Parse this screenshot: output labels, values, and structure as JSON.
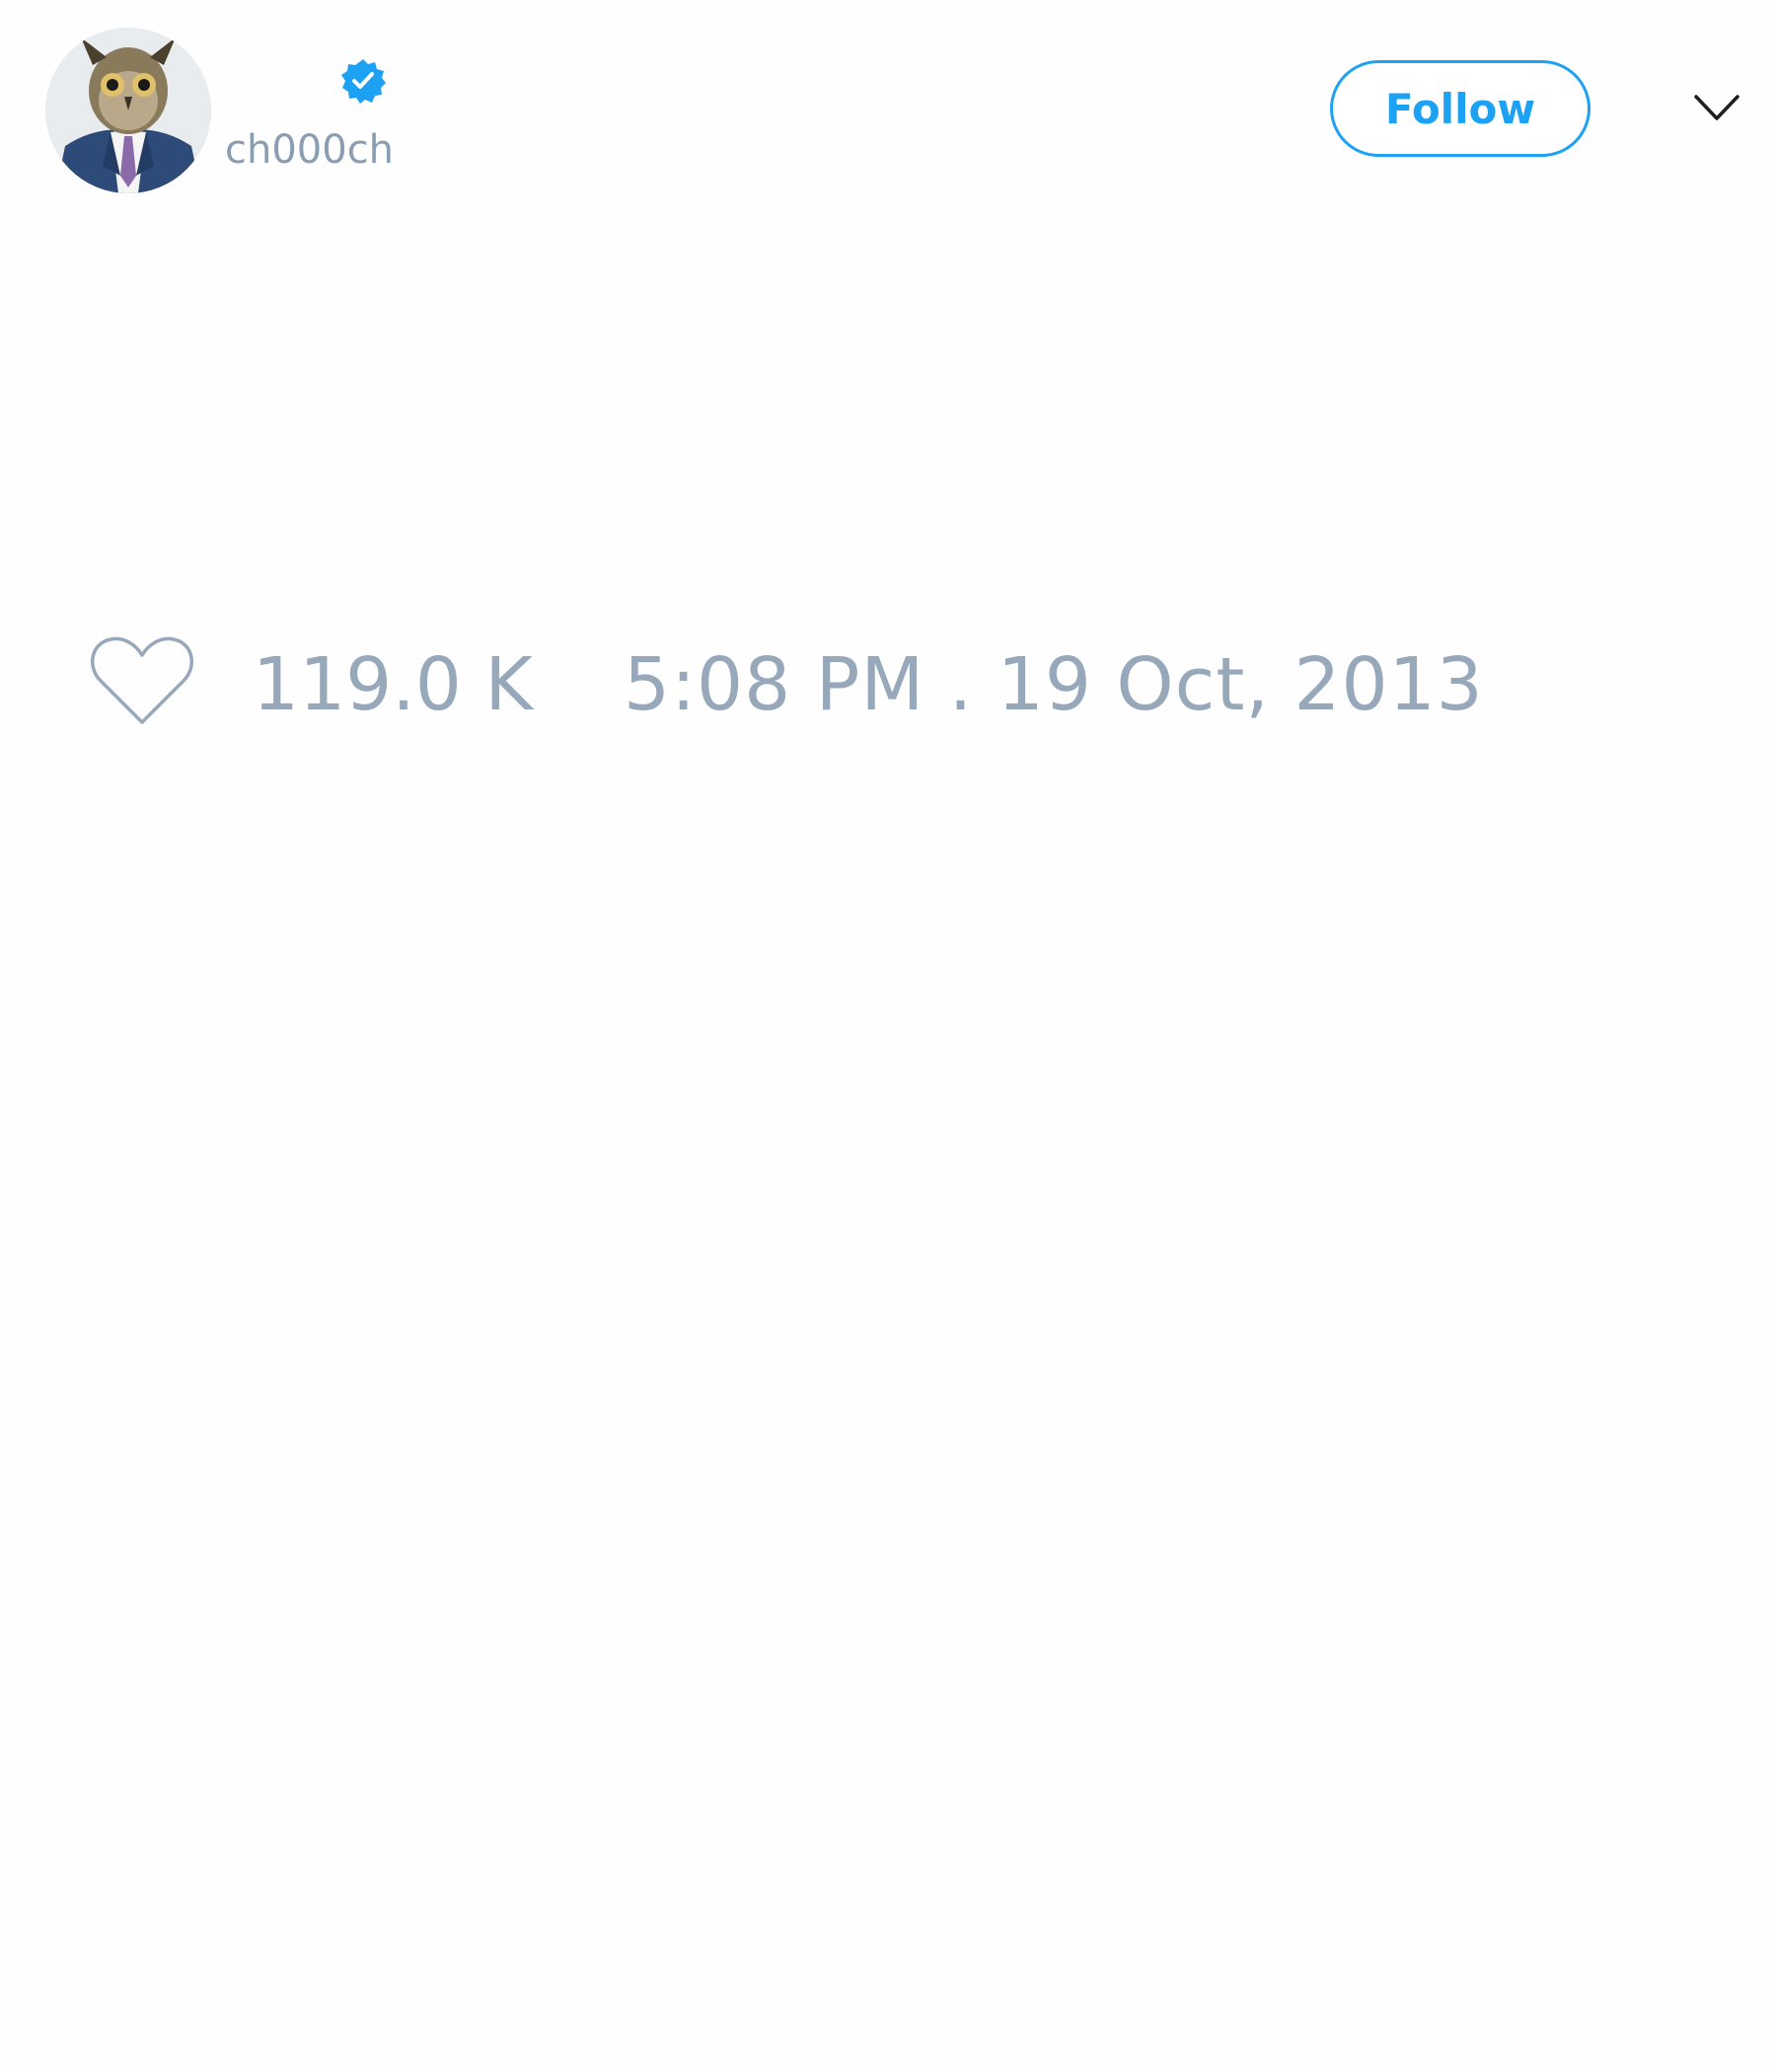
{
  "tweet": {
    "author": {
      "handle": "ch000ch",
      "verified": true,
      "avatar_icon": "owl-in-suit-avatar"
    },
    "follow_label": "Follow",
    "menu_icon": "chevron-down-icon",
    "likes": "119.0 K",
    "timestamp": "5:08 PM . 19 Oct, 2013"
  },
  "colors": {
    "accent": "#1da1f2",
    "muted_text": "#8b9db2",
    "background": "#fefefe"
  }
}
